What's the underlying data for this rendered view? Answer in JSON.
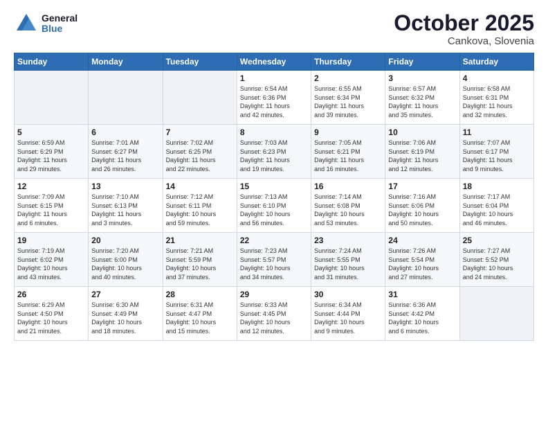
{
  "header": {
    "logo_general": "General",
    "logo_blue": "Blue",
    "month": "October 2025",
    "location": "Cankova, Slovenia"
  },
  "weekdays": [
    "Sunday",
    "Monday",
    "Tuesday",
    "Wednesday",
    "Thursday",
    "Friday",
    "Saturday"
  ],
  "weeks": [
    [
      {
        "day": "",
        "info": ""
      },
      {
        "day": "",
        "info": ""
      },
      {
        "day": "",
        "info": ""
      },
      {
        "day": "1",
        "info": "Sunrise: 6:54 AM\nSunset: 6:36 PM\nDaylight: 11 hours\nand 42 minutes."
      },
      {
        "day": "2",
        "info": "Sunrise: 6:55 AM\nSunset: 6:34 PM\nDaylight: 11 hours\nand 39 minutes."
      },
      {
        "day": "3",
        "info": "Sunrise: 6:57 AM\nSunset: 6:32 PM\nDaylight: 11 hours\nand 35 minutes."
      },
      {
        "day": "4",
        "info": "Sunrise: 6:58 AM\nSunset: 6:31 PM\nDaylight: 11 hours\nand 32 minutes."
      }
    ],
    [
      {
        "day": "5",
        "info": "Sunrise: 6:59 AM\nSunset: 6:29 PM\nDaylight: 11 hours\nand 29 minutes."
      },
      {
        "day": "6",
        "info": "Sunrise: 7:01 AM\nSunset: 6:27 PM\nDaylight: 11 hours\nand 26 minutes."
      },
      {
        "day": "7",
        "info": "Sunrise: 7:02 AM\nSunset: 6:25 PM\nDaylight: 11 hours\nand 22 minutes."
      },
      {
        "day": "8",
        "info": "Sunrise: 7:03 AM\nSunset: 6:23 PM\nDaylight: 11 hours\nand 19 minutes."
      },
      {
        "day": "9",
        "info": "Sunrise: 7:05 AM\nSunset: 6:21 PM\nDaylight: 11 hours\nand 16 minutes."
      },
      {
        "day": "10",
        "info": "Sunrise: 7:06 AM\nSunset: 6:19 PM\nDaylight: 11 hours\nand 12 minutes."
      },
      {
        "day": "11",
        "info": "Sunrise: 7:07 AM\nSunset: 6:17 PM\nDaylight: 11 hours\nand 9 minutes."
      }
    ],
    [
      {
        "day": "12",
        "info": "Sunrise: 7:09 AM\nSunset: 6:15 PM\nDaylight: 11 hours\nand 6 minutes."
      },
      {
        "day": "13",
        "info": "Sunrise: 7:10 AM\nSunset: 6:13 PM\nDaylight: 11 hours\nand 3 minutes."
      },
      {
        "day": "14",
        "info": "Sunrise: 7:12 AM\nSunset: 6:11 PM\nDaylight: 10 hours\nand 59 minutes."
      },
      {
        "day": "15",
        "info": "Sunrise: 7:13 AM\nSunset: 6:10 PM\nDaylight: 10 hours\nand 56 minutes."
      },
      {
        "day": "16",
        "info": "Sunrise: 7:14 AM\nSunset: 6:08 PM\nDaylight: 10 hours\nand 53 minutes."
      },
      {
        "day": "17",
        "info": "Sunrise: 7:16 AM\nSunset: 6:06 PM\nDaylight: 10 hours\nand 50 minutes."
      },
      {
        "day": "18",
        "info": "Sunrise: 7:17 AM\nSunset: 6:04 PM\nDaylight: 10 hours\nand 46 minutes."
      }
    ],
    [
      {
        "day": "19",
        "info": "Sunrise: 7:19 AM\nSunset: 6:02 PM\nDaylight: 10 hours\nand 43 minutes."
      },
      {
        "day": "20",
        "info": "Sunrise: 7:20 AM\nSunset: 6:00 PM\nDaylight: 10 hours\nand 40 minutes."
      },
      {
        "day": "21",
        "info": "Sunrise: 7:21 AM\nSunset: 5:59 PM\nDaylight: 10 hours\nand 37 minutes."
      },
      {
        "day": "22",
        "info": "Sunrise: 7:23 AM\nSunset: 5:57 PM\nDaylight: 10 hours\nand 34 minutes."
      },
      {
        "day": "23",
        "info": "Sunrise: 7:24 AM\nSunset: 5:55 PM\nDaylight: 10 hours\nand 31 minutes."
      },
      {
        "day": "24",
        "info": "Sunrise: 7:26 AM\nSunset: 5:54 PM\nDaylight: 10 hours\nand 27 minutes."
      },
      {
        "day": "25",
        "info": "Sunrise: 7:27 AM\nSunset: 5:52 PM\nDaylight: 10 hours\nand 24 minutes."
      }
    ],
    [
      {
        "day": "26",
        "info": "Sunrise: 6:29 AM\nSunset: 4:50 PM\nDaylight: 10 hours\nand 21 minutes."
      },
      {
        "day": "27",
        "info": "Sunrise: 6:30 AM\nSunset: 4:49 PM\nDaylight: 10 hours\nand 18 minutes."
      },
      {
        "day": "28",
        "info": "Sunrise: 6:31 AM\nSunset: 4:47 PM\nDaylight: 10 hours\nand 15 minutes."
      },
      {
        "day": "29",
        "info": "Sunrise: 6:33 AM\nSunset: 4:45 PM\nDaylight: 10 hours\nand 12 minutes."
      },
      {
        "day": "30",
        "info": "Sunrise: 6:34 AM\nSunset: 4:44 PM\nDaylight: 10 hours\nand 9 minutes."
      },
      {
        "day": "31",
        "info": "Sunrise: 6:36 AM\nSunset: 4:42 PM\nDaylight: 10 hours\nand 6 minutes."
      },
      {
        "day": "",
        "info": ""
      }
    ]
  ]
}
